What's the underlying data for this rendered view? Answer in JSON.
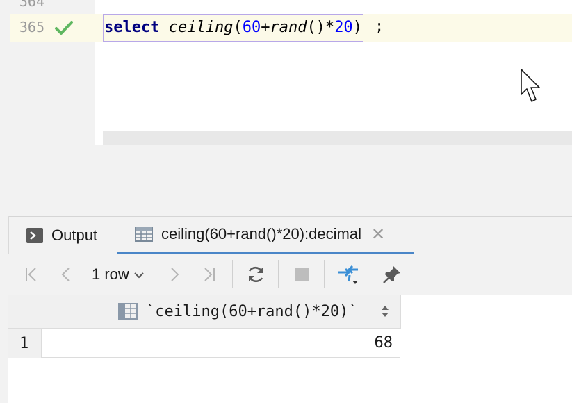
{
  "editor": {
    "prev_line_number": "364",
    "current_line_number": "365",
    "status": "check-icon",
    "code": {
      "keyword": "select",
      "fn1": "ceiling",
      "p1": "(",
      "n1": "60",
      "plus": "+",
      "fn2": "rand",
      "p2": "()*",
      "n2": "20",
      "p3": ")",
      "semicolon": ";"
    }
  },
  "results_panel": {
    "tabs": [
      {
        "label": "Output",
        "icon": "terminal-icon"
      },
      {
        "label": "ceiling(60+rand()*20):decimal",
        "icon": "table-icon",
        "close": "✕"
      }
    ],
    "toolbar": {
      "rows_label": "1 row"
    },
    "grid": {
      "columns": [
        "`ceiling(60+rand()*20)`"
      ],
      "rows": [
        {
          "num": "1",
          "values": [
            "68"
          ]
        }
      ]
    }
  },
  "colors": {
    "keyword": "#000080",
    "number": "#0000ff",
    "check": "#5fb760",
    "active_tab_underline": "#4a86c8",
    "current_line_bg": "#fcfae8"
  }
}
